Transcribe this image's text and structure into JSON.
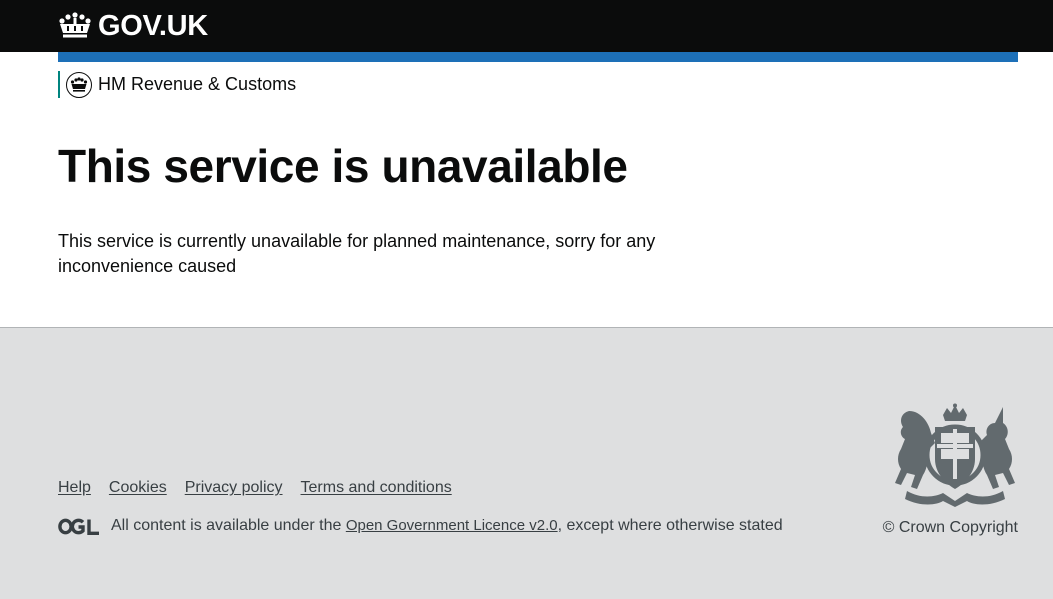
{
  "header": {
    "logo_text": "GOV.UK"
  },
  "organisation": {
    "name": "HM Revenue & Customs"
  },
  "main": {
    "title": "This service is unavailable",
    "body": "This service is currently unavailable for planned maintenance, sorry for any inconvenience caused"
  },
  "footer": {
    "links": [
      "Help",
      "Cookies",
      "Privacy policy",
      "Terms and conditions"
    ],
    "licence_prefix": "All content is available under the ",
    "licence_link": "Open Government Licence v2.0",
    "licence_suffix": ", except where otherwise stated",
    "copyright": "© Crown Copyright"
  },
  "colors": {
    "header_bg": "#0b0c0c",
    "blue_bar": "#1d70b8",
    "org_border": "#00847f",
    "footer_bg": "#dedfe0",
    "footer_text": "#383f43"
  },
  "icons": {
    "logo": "crown-icon",
    "organisation": "crest-icon",
    "licence": "ogl-icon",
    "footer_crest": "royal-coat-of-arms-icon"
  }
}
